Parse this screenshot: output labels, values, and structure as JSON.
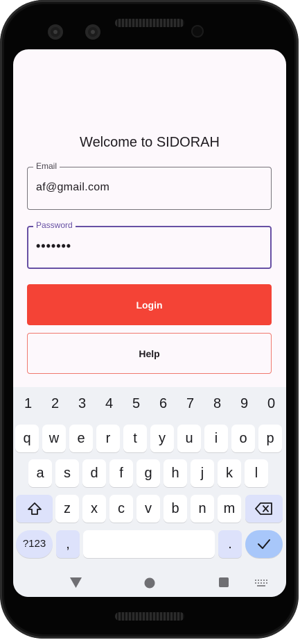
{
  "screen": {
    "title": "Welcome to SIDORAH",
    "email": {
      "label": "Email",
      "value": "af@gmail.com"
    },
    "password": {
      "label": "Password",
      "value": "•••••••"
    },
    "login_label": "Login",
    "help_label": "Help"
  },
  "keyboard": {
    "numbers": [
      "1",
      "2",
      "3",
      "4",
      "5",
      "6",
      "7",
      "8",
      "9",
      "0"
    ],
    "row1": [
      "q",
      "w",
      "e",
      "r",
      "t",
      "y",
      "u",
      "i",
      "o",
      "p"
    ],
    "row2": [
      "a",
      "s",
      "d",
      "f",
      "g",
      "h",
      "j",
      "k",
      "l"
    ],
    "row3": [
      "z",
      "x",
      "c",
      "v",
      "b",
      "n",
      "m"
    ],
    "symbols_label": "?123",
    "comma_label": ",",
    "period_label": "."
  },
  "colors": {
    "accent": "#6750a4",
    "login": "#f44336",
    "help_border": "#f0796e",
    "enter": "#a8c7fa"
  },
  "icons": [
    "shift-icon",
    "backspace-icon",
    "checkmark-icon",
    "back-triangle-icon",
    "home-circle-icon",
    "recents-square-icon",
    "keyboard-switch-icon"
  ]
}
